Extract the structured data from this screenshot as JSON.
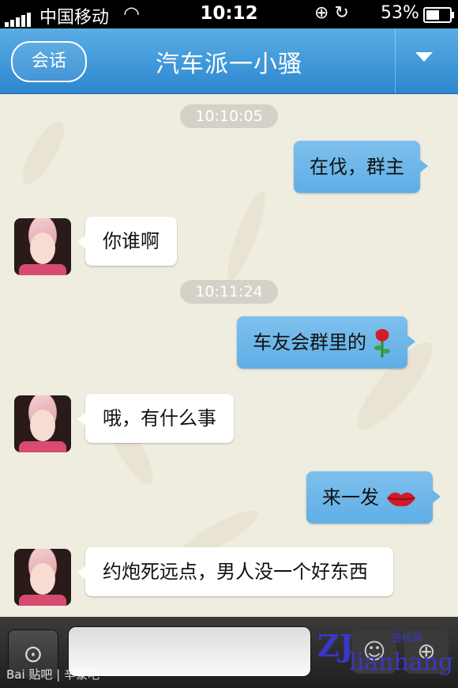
{
  "status_bar": {
    "carrier": "中国移动",
    "time": "10:12",
    "battery": "53%"
  },
  "nav": {
    "back_label": "会话",
    "title": "汽车派一小骚"
  },
  "messages": [
    {
      "type": "timestamp",
      "text": "10:10:05"
    },
    {
      "type": "sent",
      "text": "在伐，群主"
    },
    {
      "type": "received",
      "text": "你谁啊"
    },
    {
      "type": "timestamp",
      "text": "10:11:24"
    },
    {
      "type": "sent",
      "text": "车友会群里的",
      "emoji": "rose-icon"
    },
    {
      "type": "received",
      "text": "哦，有什么事"
    },
    {
      "type": "sent",
      "text": "来一发",
      "emoji": "lips-icon"
    },
    {
      "type": "received",
      "text": "约炮死远点，男人没一个好东西"
    }
  ],
  "input_bar": {
    "voice_icon": "microphone-icon",
    "emoji_icon": "smiley-icon",
    "more_icon": "plus-icon"
  },
  "watermarks": {
    "baidu": "Bai 贴吧 | 辛蒙吧",
    "zj_brand": "ZJ",
    "zj_sub": "lianhang",
    "zj_cn": "连杭网"
  },
  "colors": {
    "nav_blue": "#3a93d6",
    "sent_bubble": "#6bb5e8",
    "received_bubble": "#ffffff",
    "chat_bg": "#efece0"
  }
}
